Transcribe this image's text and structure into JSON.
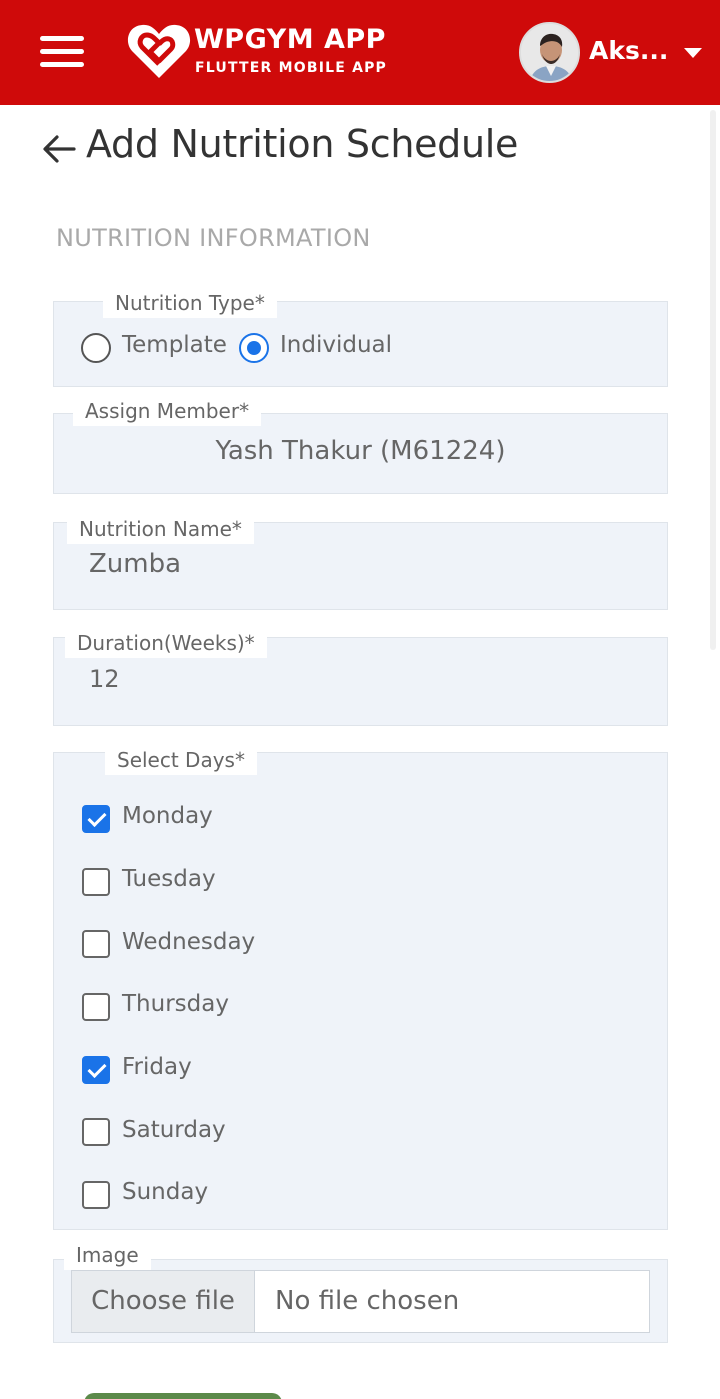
{
  "header": {
    "app_name": "WPGYM APP",
    "app_subtitle": "FLUTTER MOBILE APP",
    "user_name": "Aks...",
    "bg_color": "#cf0a0a"
  },
  "page": {
    "title": "Add Nutrition Schedule",
    "section_label": "NUTRITION INFORMATION"
  },
  "nutrition_type": {
    "legend": "Nutrition Type*",
    "options": [
      {
        "label": "Template",
        "checked": false
      },
      {
        "label": "Individual",
        "checked": true
      }
    ]
  },
  "assign_member": {
    "legend": "Assign Member*",
    "value": "Yash Thakur (M61224)"
  },
  "nutrition_name": {
    "legend": "Nutrition Name*",
    "value": "Zumba"
  },
  "duration": {
    "legend": "Duration(Weeks)*",
    "value": "12"
  },
  "select_days": {
    "legend": "Select Days*",
    "days": [
      {
        "label": "Monday",
        "checked": true
      },
      {
        "label": "Tuesday",
        "checked": false
      },
      {
        "label": "Wednesday",
        "checked": false
      },
      {
        "label": "Thursday",
        "checked": false
      },
      {
        "label": "Friday",
        "checked": true
      },
      {
        "label": "Saturday",
        "checked": false
      },
      {
        "label": "Sunday",
        "checked": false
      }
    ]
  },
  "image": {
    "legend": "Image",
    "button_label": "Choose file",
    "status": "No file chosen"
  },
  "colors": {
    "accent": "#1a73e8",
    "field_bg": "#eff3f9"
  }
}
